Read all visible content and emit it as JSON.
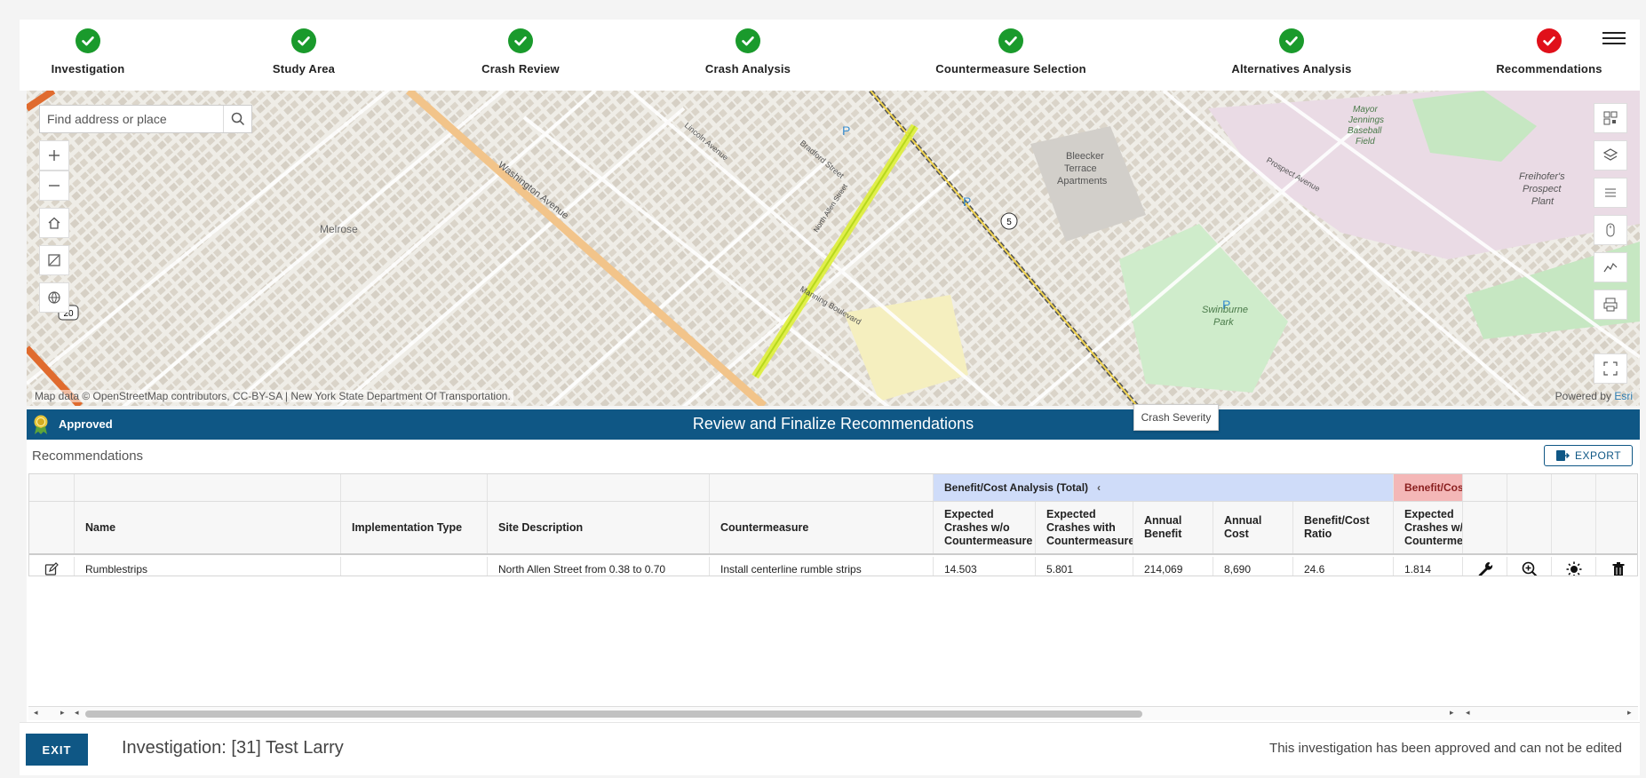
{
  "stepper": {
    "steps": [
      {
        "label": "Investigation",
        "status": "complete"
      },
      {
        "label": "Study Area",
        "status": "complete"
      },
      {
        "label": "Crash Review",
        "status": "complete"
      },
      {
        "label": "Crash Analysis",
        "status": "complete"
      },
      {
        "label": "Countermeasure Selection",
        "status": "complete"
      },
      {
        "label": "Alternatives Analysis",
        "status": "complete"
      },
      {
        "label": "Recommendations",
        "status": "current"
      }
    ],
    "complete_color": "#1a9a2c",
    "current_color": "#e0101a"
  },
  "map": {
    "search_placeholder": "Find address or place",
    "attribution": "Map data © OpenStreetMap contributors, CC-BY-SA | New York State Department Of Transportation.",
    "powered_by_prefix": "Powered by",
    "powered_by_brand": "Esri",
    "labels": {
      "washington": "Washington Avenue",
      "melrose": "Melrose",
      "bleecker1": "Bleecker",
      "bleecker2": "Terrace",
      "bleecker3": "Apartments",
      "mayor1": "Mayor",
      "mayor2": "Jennings",
      "mayor3": "Baseball",
      "mayor4": "Field",
      "freihofer1": "Freihofer's",
      "freihofer2": "Prospect",
      "freihofer3": "Plant",
      "swinburne1": "Swinburne",
      "swinburne2": "Park",
      "route20": "20",
      "route5": "5",
      "prospect": "Prospect Avenue",
      "manning": "Manning Boulevard",
      "lincoln": "Lincoln Avenue",
      "bradford": "Bradford Street",
      "allen": "North Allen Street"
    },
    "tooltip": "Crash Severity"
  },
  "banner": {
    "status": "Approved",
    "title": "Review and Finalize Recommendations",
    "color": "#0f5785"
  },
  "recommendations": {
    "title": "Recommendations",
    "export_label": "EXPORT",
    "group_headers": {
      "bc_total": "Benefit/Cost Analysis (Total)",
      "bc_next": "Benefit/Cos"
    },
    "columns": {
      "name": "Name",
      "implementation_type": "Implementation Type",
      "site_description": "Site Description",
      "countermeasure": "Countermeasure",
      "crashes_without": "Expected Crashes w/o Countermeasure",
      "crashes_with": "Expected Crashes with Countermeasure",
      "annual_benefit": "Annual Benefit",
      "annual_cost": "Annual Cost",
      "bc_ratio": "Benefit/Cost Ratio",
      "crashes_without_2": "Expected Crashes w/o Countermeasure"
    },
    "rows": [
      {
        "name": "Rumblestrips",
        "implementation_type": "",
        "site_description": "North Allen Street from 0.38 to 0.70",
        "countermeasure": "Install centerline rumble strips",
        "crashes_without": "14.503",
        "crashes_with": "5.801",
        "annual_benefit": "214,069",
        "annual_cost": "8,690",
        "bc_ratio": "24.6",
        "crashes_without_2": "1.814"
      }
    ]
  },
  "footer": {
    "exit_label": "EXIT",
    "investigation_title": "Investigation: [31] Test Larry",
    "approved_note": "This investigation has been approved and can not be edited"
  }
}
